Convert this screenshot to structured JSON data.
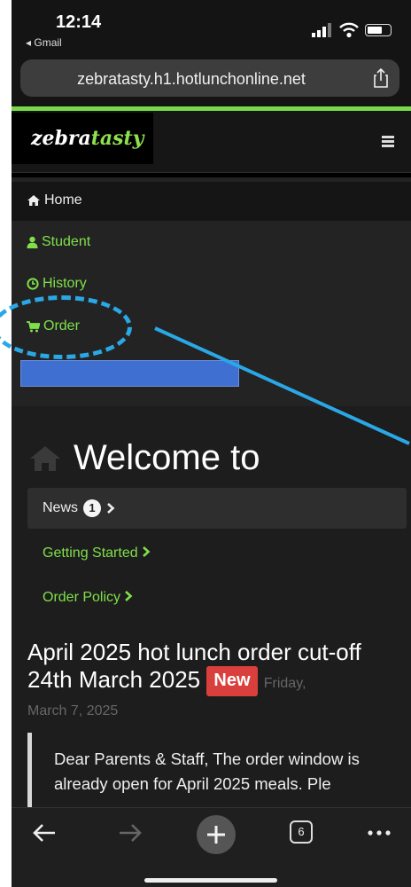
{
  "status_bar": {
    "time": "12:14",
    "back_app": "◂ Gmail"
  },
  "browser": {
    "url": "zebratasty.h1.hotlunchonline.net",
    "tab_count": "6"
  },
  "site": {
    "logo_part1": "zebra",
    "logo_part2": "tasty",
    "accent_color": "#7fe04a"
  },
  "nav": {
    "home": "Home",
    "student": "Student",
    "history": "History",
    "order": "Order"
  },
  "main": {
    "welcome": "Welcome to",
    "news_tab": "News",
    "news_count": "1",
    "getting_started": "Getting Started",
    "order_policy": "Order Policy",
    "post": {
      "title": "April 2025 hot lunch order cut-off 24th March 2025",
      "badge": "New",
      "date_part1": "Friday,",
      "date_part2": "March 7, 2025",
      "excerpt": "Dear Parents & Staff,  The order window is already open for April 2025 meals. Ple"
    }
  },
  "annotation": {
    "circle_color": "#2aa8e6"
  }
}
